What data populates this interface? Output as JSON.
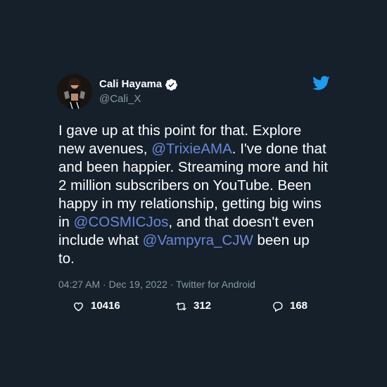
{
  "colors": {
    "background": "#15202b",
    "text": "#ffffff",
    "secondary_text": "#8899a6",
    "mention": "#6b86d8",
    "twitter_blue": "#1d9bf0"
  },
  "author": {
    "name": "Cali Hayama",
    "handle": "@Cali_X",
    "verified": true,
    "avatar_icon": "user-avatar"
  },
  "brand_icon": "twitter-bird-icon",
  "tweet": {
    "segments": [
      {
        "type": "text",
        "value": "I gave up at this point for that. Explore new avenues, "
      },
      {
        "type": "mention",
        "value": "@TrixieAMA"
      },
      {
        "type": "text",
        "value": ". I've done that and been happier. Streaming more and hit 2 million subscribers on YouTube. Been happy in my relationship, getting big wins in "
      },
      {
        "type": "mention",
        "value": "@COSMICJos"
      },
      {
        "type": "text",
        "value": ", and that doesn't even include what "
      },
      {
        "type": "mention",
        "value": "@Vampyra_CJW"
      },
      {
        "type": "text",
        "value": " been up to."
      }
    ]
  },
  "meta": {
    "time": "04:27 AM",
    "separator": "·",
    "date": "Dec 19, 2022",
    "source": "Twitter for Android"
  },
  "stats": {
    "likes": "10416",
    "retweets": "312",
    "replies": "168"
  }
}
